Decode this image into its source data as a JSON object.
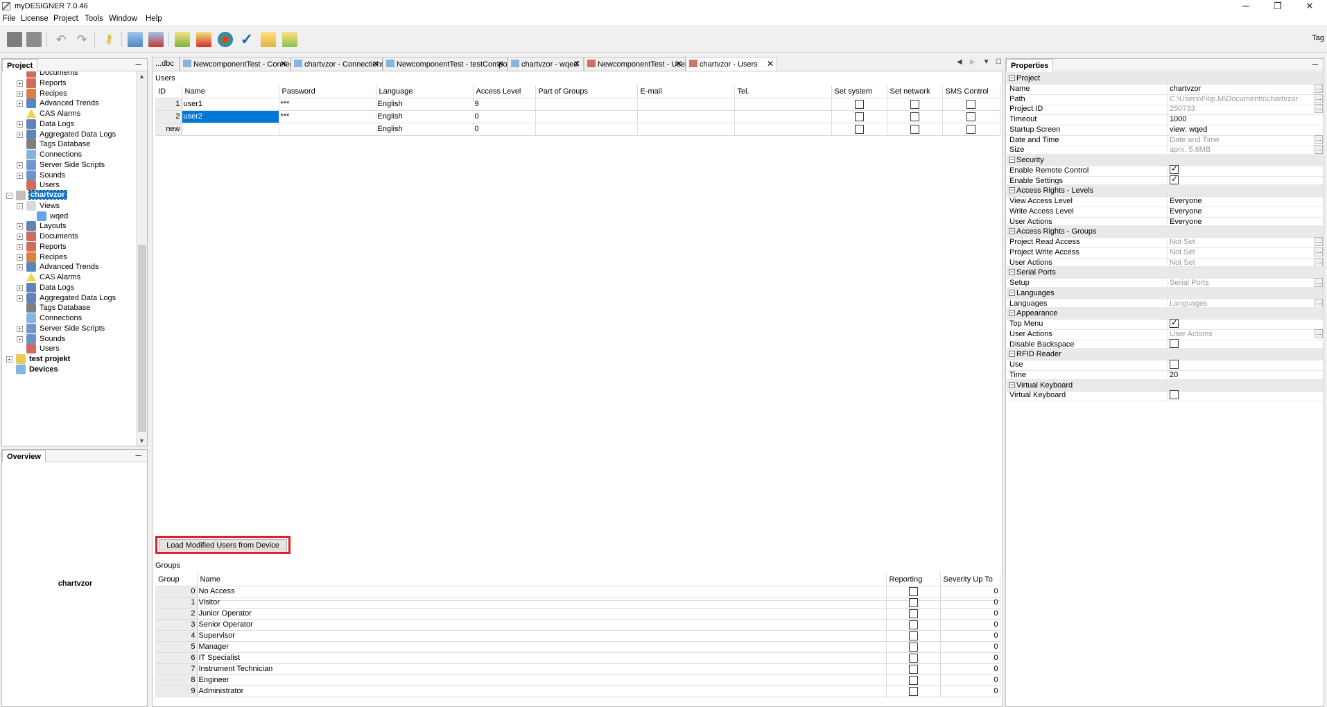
{
  "app": {
    "title": "myDESIGNER 7.0.46"
  },
  "menu": [
    "File",
    "License",
    "Project",
    "Tools",
    "Window",
    "Help"
  ],
  "toolbar": {
    "tag_label": "Tag"
  },
  "project_panel": {
    "title": "Project",
    "items": [
      {
        "label": "Documents",
        "icon": "documents-icon",
        "bold": false
      },
      {
        "label": "Reports",
        "icon": "reports-icon",
        "bold": false
      },
      {
        "label": "Recipes",
        "icon": "recipes-icon",
        "bold": false
      },
      {
        "label": "Advanced Trends",
        "icon": "trends-icon",
        "bold": false
      },
      {
        "label": "CAS Alarms",
        "icon": "alarm-icon",
        "bold": false
      },
      {
        "label": "Data Logs",
        "icon": "datalog-icon",
        "bold": false
      },
      {
        "label": "Aggregated Data Logs",
        "icon": "datalog-icon",
        "bold": false
      },
      {
        "label": "Tags Database",
        "icon": "database-icon",
        "bold": false
      },
      {
        "label": "Connections",
        "icon": "connection-icon",
        "bold": false
      },
      {
        "label": "Server Side Scripts",
        "icon": "script-icon",
        "bold": false
      },
      {
        "label": "Sounds",
        "icon": "speaker-icon",
        "bold": false
      },
      {
        "label": "Users",
        "icon": "users-icon",
        "bold": false
      },
      {
        "label": "chartvzor",
        "icon": "project-icon",
        "bold": true,
        "selected": true
      },
      {
        "label": "Views",
        "icon": "views-icon",
        "bold": false
      },
      {
        "label": "wqed",
        "icon": "view-icon",
        "bold": false
      },
      {
        "label": "Layouts",
        "icon": "layouts-icon",
        "bold": false
      },
      {
        "label": "Documents",
        "icon": "documents-icon",
        "bold": false
      },
      {
        "label": "Reports",
        "icon": "reports-icon",
        "bold": false
      },
      {
        "label": "Recipes",
        "icon": "recipes-icon",
        "bold": false
      },
      {
        "label": "Advanced Trends",
        "icon": "trends-icon",
        "bold": false
      },
      {
        "label": "CAS Alarms",
        "icon": "alarm-icon",
        "bold": false
      },
      {
        "label": "Data Logs",
        "icon": "datalog-icon",
        "bold": false
      },
      {
        "label": "Aggregated Data Logs",
        "icon": "datalog-icon",
        "bold": false
      },
      {
        "label": "Tags Database",
        "icon": "database-icon",
        "bold": false
      },
      {
        "label": "Connections",
        "icon": "connection-icon",
        "bold": false
      },
      {
        "label": "Server Side Scripts",
        "icon": "script-icon",
        "bold": false
      },
      {
        "label": "Sounds",
        "icon": "speaker-icon",
        "bold": false
      },
      {
        "label": "Users",
        "icon": "users-icon",
        "bold": false
      },
      {
        "label": "test projekt",
        "icon": "folder-icon",
        "bold": true
      },
      {
        "label": "Devices",
        "icon": "devices-icon",
        "bold": true
      }
    ]
  },
  "overview": {
    "title": "Overview",
    "text": "chartvzor"
  },
  "tabs": [
    {
      "label": "...dbc",
      "active": false
    },
    {
      "label": "NewcomponentTest - Connections",
      "active": false
    },
    {
      "label": "chartvzor - Connections",
      "active": false
    },
    {
      "label": "NewcomponentTest - testComponent",
      "active": false
    },
    {
      "label": "chartvzor - wqed",
      "active": false
    },
    {
      "label": "NewcomponentTest - Users",
      "active": false
    },
    {
      "label": "chartvzor - Users",
      "active": true
    }
  ],
  "users": {
    "section_label": "Users",
    "columns": [
      "ID",
      "Name",
      "Password",
      "Language",
      "Access Level",
      "Part of Groups",
      "E-mail",
      "Tel.",
      "Set system",
      "Set network",
      "SMS Control"
    ],
    "rows": [
      {
        "id": "1",
        "name": "user1",
        "password": "***",
        "language": "English",
        "access_level": "9",
        "groups": "",
        "email": "",
        "tel": "",
        "set_system": false,
        "set_network": false,
        "sms_control": false
      },
      {
        "id": "2",
        "name": "user2",
        "password": "***",
        "language": "English",
        "access_level": "0",
        "groups": "",
        "email": "",
        "tel": "",
        "set_system": false,
        "set_network": false,
        "sms_control": false
      },
      {
        "id": "new",
        "name": "",
        "password": "",
        "language": "English",
        "access_level": "0",
        "groups": "",
        "email": "",
        "tel": "",
        "set_system": false,
        "set_network": false,
        "sms_control": false
      }
    ]
  },
  "load_button": "Load Modified Users from Device",
  "groups": {
    "section_label": "Groups",
    "columns": [
      "Group",
      "Name",
      "Reporting",
      "Severity Up To"
    ],
    "rows": [
      {
        "id": "0",
        "name": "No Access",
        "reporting": false,
        "severity": "0"
      },
      {
        "id": "1",
        "name": "Visitor",
        "reporting": false,
        "severity": "0"
      },
      {
        "id": "2",
        "name": "Junior Operator",
        "reporting": false,
        "severity": "0"
      },
      {
        "id": "3",
        "name": "Senior Operator",
        "reporting": false,
        "severity": "0"
      },
      {
        "id": "4",
        "name": "Supervisor",
        "reporting": false,
        "severity": "0"
      },
      {
        "id": "5",
        "name": "Manager",
        "reporting": false,
        "severity": "0"
      },
      {
        "id": "6",
        "name": "IT Specialist",
        "reporting": false,
        "severity": "0"
      },
      {
        "id": "7",
        "name": "Instrument Technician",
        "reporting": false,
        "severity": "0"
      },
      {
        "id": "8",
        "name": "Engineer",
        "reporting": false,
        "severity": "0"
      },
      {
        "id": "9",
        "name": "Administrator",
        "reporting": false,
        "severity": "0"
      }
    ]
  },
  "properties": {
    "title": "Properties",
    "rows": [
      {
        "type": "cat",
        "name": "Project"
      },
      {
        "type": "prop",
        "name": "Name",
        "value": "chartvzor",
        "grey": false,
        "dots": true
      },
      {
        "type": "prop",
        "name": "Path",
        "value": "C:\\Users\\Filip.M\\Documents\\chartvzor",
        "grey": true,
        "dots": true
      },
      {
        "type": "prop",
        "name": "Project ID",
        "value": "250733",
        "grey": true,
        "dots": true
      },
      {
        "type": "prop",
        "name": "Timeout",
        "value": "1000",
        "grey": false
      },
      {
        "type": "prop",
        "name": "Startup Screen",
        "value": "view: wqed",
        "grey": false
      },
      {
        "type": "prop",
        "name": "Date and Time",
        "value": "Date and Time",
        "grey": true,
        "dots": true
      },
      {
        "type": "prop",
        "name": "Size",
        "value": "aprx. 5.6MB",
        "grey": true,
        "dots": true
      },
      {
        "type": "cat",
        "name": "Security"
      },
      {
        "type": "check",
        "name": "Enable Remote Control",
        "checked": true
      },
      {
        "type": "check",
        "name": "Enable Settings",
        "checked": true
      },
      {
        "type": "cat",
        "name": "Access Rights - Levels"
      },
      {
        "type": "prop",
        "name": "View Access Level",
        "value": "Everyone",
        "grey": false
      },
      {
        "type": "prop",
        "name": "Write Access Level",
        "value": "Everyone",
        "grey": false
      },
      {
        "type": "prop",
        "name": "User Actions",
        "value": "Everyone",
        "grey": false
      },
      {
        "type": "cat",
        "name": "Access Rights - Groups"
      },
      {
        "type": "prop",
        "name": "Project Read Access",
        "value": "Not Set",
        "grey": true,
        "dots": true
      },
      {
        "type": "prop",
        "name": "Project Write Access",
        "value": "Not Set",
        "grey": true,
        "dots": true
      },
      {
        "type": "prop",
        "name": "User Actions",
        "value": "Not Set",
        "grey": true,
        "dots": true
      },
      {
        "type": "cat",
        "name": "Serial Ports"
      },
      {
        "type": "prop",
        "name": "Setup",
        "value": "Serial Ports",
        "grey": true,
        "dots": true
      },
      {
        "type": "cat",
        "name": "Languages"
      },
      {
        "type": "prop",
        "name": "Languages",
        "value": "Languages",
        "grey": true,
        "dots": true
      },
      {
        "type": "cat",
        "name": "Appearance"
      },
      {
        "type": "check",
        "name": "Top Menu",
        "checked": true
      },
      {
        "type": "prop",
        "name": "User Actions",
        "value": "User Actions",
        "grey": true,
        "dots": true
      },
      {
        "type": "check",
        "name": "Disable Backspace",
        "checked": false
      },
      {
        "type": "cat",
        "name": "RFID Reader"
      },
      {
        "type": "check",
        "name": "Use",
        "checked": false
      },
      {
        "type": "prop",
        "name": "Time",
        "value": "20",
        "grey": false
      },
      {
        "type": "cat",
        "name": "Virtual Keyboard"
      },
      {
        "type": "check",
        "name": "Virtual Keyboard",
        "checked": false
      }
    ]
  }
}
